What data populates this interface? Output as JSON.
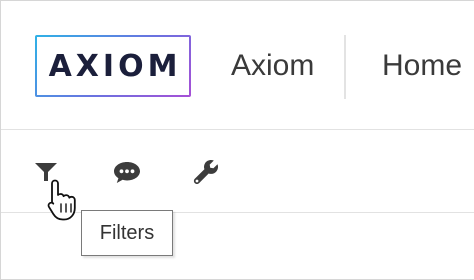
{
  "header": {
    "logo_text": "AXIOM",
    "app_name": "Axiom",
    "nav": [
      {
        "label": "Home"
      }
    ]
  },
  "toolbar": {
    "buttons": [
      {
        "icon": "filter-icon"
      },
      {
        "icon": "comment-icon"
      },
      {
        "icon": "wrench-icon"
      }
    ]
  },
  "tooltip": {
    "text": "Filters"
  },
  "colors": {
    "logo_text": "#1b1f3b",
    "logo_gradient_start": "#2fb2e6",
    "logo_gradient_end": "#a64fd6",
    "icon": "#3c3c3c",
    "text": "#3a3a3a"
  }
}
